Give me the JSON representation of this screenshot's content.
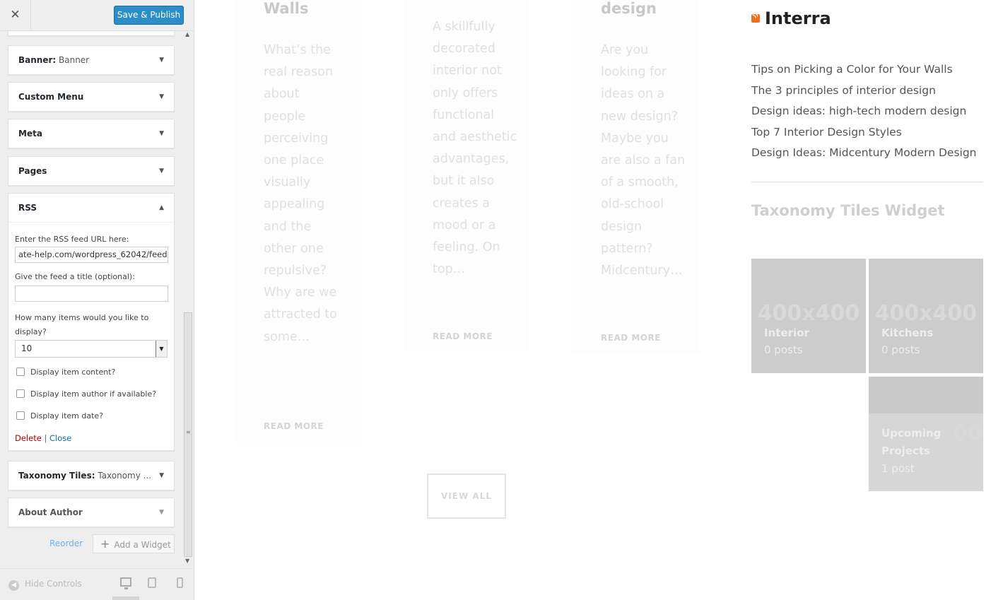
{
  "sidebar": {
    "close_label": "✕",
    "save_label": "Save & Publish",
    "widgets": [
      {
        "name": "Banner:",
        "sub": " Banner"
      },
      {
        "name": "Custom Menu",
        "sub": ""
      },
      {
        "name": "Meta",
        "sub": ""
      },
      {
        "name": "Pages",
        "sub": ""
      },
      {
        "name": "RSS",
        "sub": ""
      },
      {
        "name": "Taxonomy Tiles:",
        "sub": " Taxonomy ..."
      },
      {
        "name": "About Author",
        "sub": ""
      }
    ],
    "rss_form": {
      "url_label": "Enter the RSS feed URL here:",
      "url_value": "ate-help.com/wordpress_62042/feed",
      "title_label": "Give the feed a title (optional):",
      "title_value": "",
      "items_label": "How many items would you like to display?",
      "items_value": "10",
      "checkboxes": [
        {
          "label": "Display item content?",
          "checked": false
        },
        {
          "label": "Display item author if available?",
          "checked": false
        },
        {
          "label": "Display item date?",
          "checked": false
        }
      ],
      "delete_label": "Delete",
      "separator": "|",
      "close_label": "Close"
    },
    "reorder_label": "Reorder",
    "add_widget_label": "Add a Widget",
    "hide_controls_label": "Hide Controls",
    "icons": {
      "close": "close-icon",
      "toggle_down": "▼",
      "toggle_up": "▲",
      "add": "plus-icon",
      "hide": "arrow-left-circle-icon",
      "desktop": "desktop-icon",
      "tablet": "tablet-icon",
      "mobile": "mobile-icon"
    },
    "colors": {
      "accent": "#2b8ec7",
      "delete": "#aa0000",
      "link": "#0073aa"
    }
  },
  "preview": {
    "posts": [
      {
        "title": "Walls",
        "excerpt": "What’s the real reason about people perceiving one place visually appealing and the other one repulsive? Why are we attracted to some…",
        "read_more": "READ MORE"
      },
      {
        "title": "",
        "excerpt": "A skillfully decorated interior not only offers functional and aesthetic advantages, but it also creates a mood or a feeling. On top…",
        "read_more": "READ MORE"
      },
      {
        "title": "design",
        "excerpt": "Are you looking for ideas on a new design? Maybe you are also a fan of a smooth, old-school design pattern? Midcentury…",
        "read_more": "READ MORE"
      }
    ],
    "view_all": "VIEW ALL",
    "rss_widget": {
      "title": "Interra",
      "items": [
        "Tips on Picking a Color for Your Walls",
        "The 3 principles of interior design",
        "Design ideas: high-tech modern design",
        "Top 7 Interior Design Styles",
        "Design Ideas: Midcentury Modern Design"
      ]
    },
    "taxonomy": {
      "title": "Taxonomy Tiles Widget",
      "tiles": [
        {
          "placeholder": "400x400",
          "name": "Interior",
          "count": "0 posts"
        },
        {
          "placeholder": "400x400",
          "name": "Kitchens",
          "count": "0 posts"
        },
        {
          "placeholder": "00",
          "name": "Upcoming Projects",
          "count": "1 post"
        }
      ]
    }
  }
}
